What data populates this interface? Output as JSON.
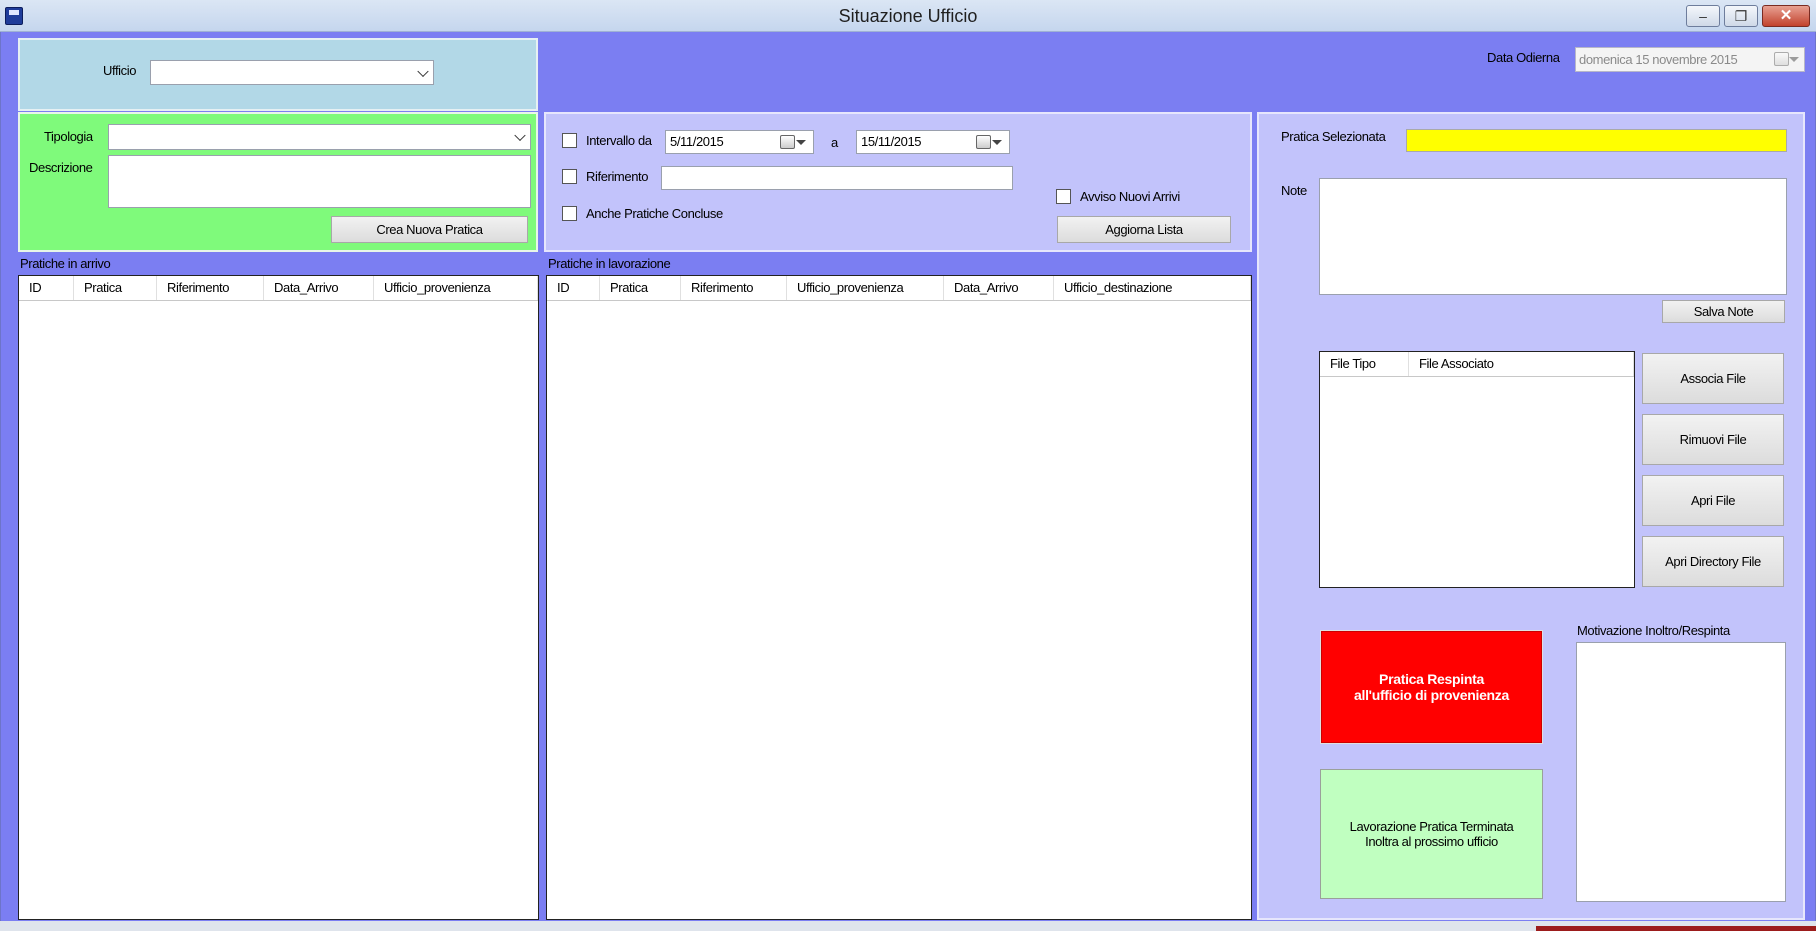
{
  "window": {
    "title": "Situazione Ufficio",
    "minimize": "–",
    "restore": "❐",
    "close": "✕",
    "icon": "floppy-disk-icon"
  },
  "office": {
    "label": "Ufficio",
    "value": ""
  },
  "date_today": {
    "label": "Data Odierna",
    "value": "domenica 15 novembre 2015"
  },
  "new_practice": {
    "type_label": "Tipologia",
    "type_value": "",
    "description_label": "Descrizione",
    "description_value": "",
    "create_button": "Crea Nuova Pratica"
  },
  "filter": {
    "interval_label": "Intervallo da",
    "date_from": "5/11/2015",
    "to_label": "a",
    "date_to": "15/11/2015",
    "reference_label": "Riferimento",
    "reference_value": "",
    "include_closed_label": "Anche Pratiche Concluse",
    "new_arrivals_label": "Avviso Nuovi Arrivi",
    "refresh_button": "Aggiorna Lista"
  },
  "incoming": {
    "title": "Pratiche in arrivo",
    "columns": [
      "ID",
      "Pratica",
      "Riferimento",
      "Data_Arrivo",
      "Ufficio_provenienza"
    ],
    "rows": []
  },
  "in_progress": {
    "title": "Pratiche in lavorazione",
    "columns": [
      "ID",
      "Pratica",
      "Riferimento",
      "Ufficio_provenienza",
      "Data_Arrivo",
      "Ufficio_destinazione"
    ],
    "rows": []
  },
  "selected": {
    "label": "Pratica Selezionata",
    "value": "",
    "highlight_color": "#ffff00",
    "notes_label": "Note",
    "notes_value": "",
    "save_notes_button": "Salva Note"
  },
  "files": {
    "columns": [
      "File Tipo",
      "File Associato"
    ],
    "rows": [],
    "associate_button": "Associa File",
    "remove_button": "Rimuovi File",
    "open_button": "Apri File",
    "open_dir_button": "Apri Directory File"
  },
  "actions": {
    "reject_line1": "Pratica Respinta",
    "reject_line2": "all'ufficio di provenienza",
    "reject_color": "#ff0000",
    "complete_line1": "Lavorazione Pratica Terminata",
    "complete_line2": "Inoltra al prossimo ufficio",
    "complete_color": "#c0ffc0",
    "motivation_label": "Motivazione Inoltro/Respinta",
    "motivation_value": ""
  },
  "colors": {
    "window_bg": "#7b7ef2",
    "office_panel": "#b2d8e7",
    "green_panel": "#7ffa7b",
    "lavender_panel": "#c2c3fb"
  }
}
